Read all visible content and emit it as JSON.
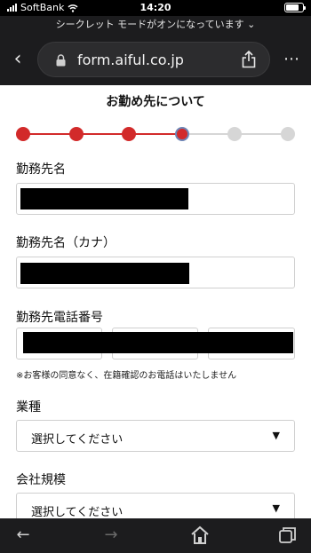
{
  "status_bar": {
    "carrier": "SoftBank",
    "time": "14:20",
    "battery_level": 0.8
  },
  "private_banner": {
    "text": "シークレット モードがオンになっています ⌄"
  },
  "browser": {
    "url": "form.aiful.co.jp",
    "more_icon": "⋯",
    "back_icon": "chevron-left-icon"
  },
  "page": {
    "title": "お勤め先について",
    "progress": {
      "total_steps": 6,
      "current_step": 4
    },
    "fields": {
      "employer_name_label": "勤務先名",
      "employer_kana_label": "勤務先名（カナ）",
      "employer_phone_label": "勤務先電話番号",
      "phone_note": "※お客様の同意なく、在籍確認のお電話はいたしません",
      "industry_label": "業種",
      "industry_value": "選択してください",
      "company_size_label": "会社規模",
      "company_size_value": "選択してください"
    }
  },
  "toolbar": {
    "back": "←",
    "forward": "→"
  },
  "colors": {
    "accent_red": "#d22a2a",
    "inactive_step": "#d6d6d6",
    "chrome_bg": "#1c1c1e"
  }
}
